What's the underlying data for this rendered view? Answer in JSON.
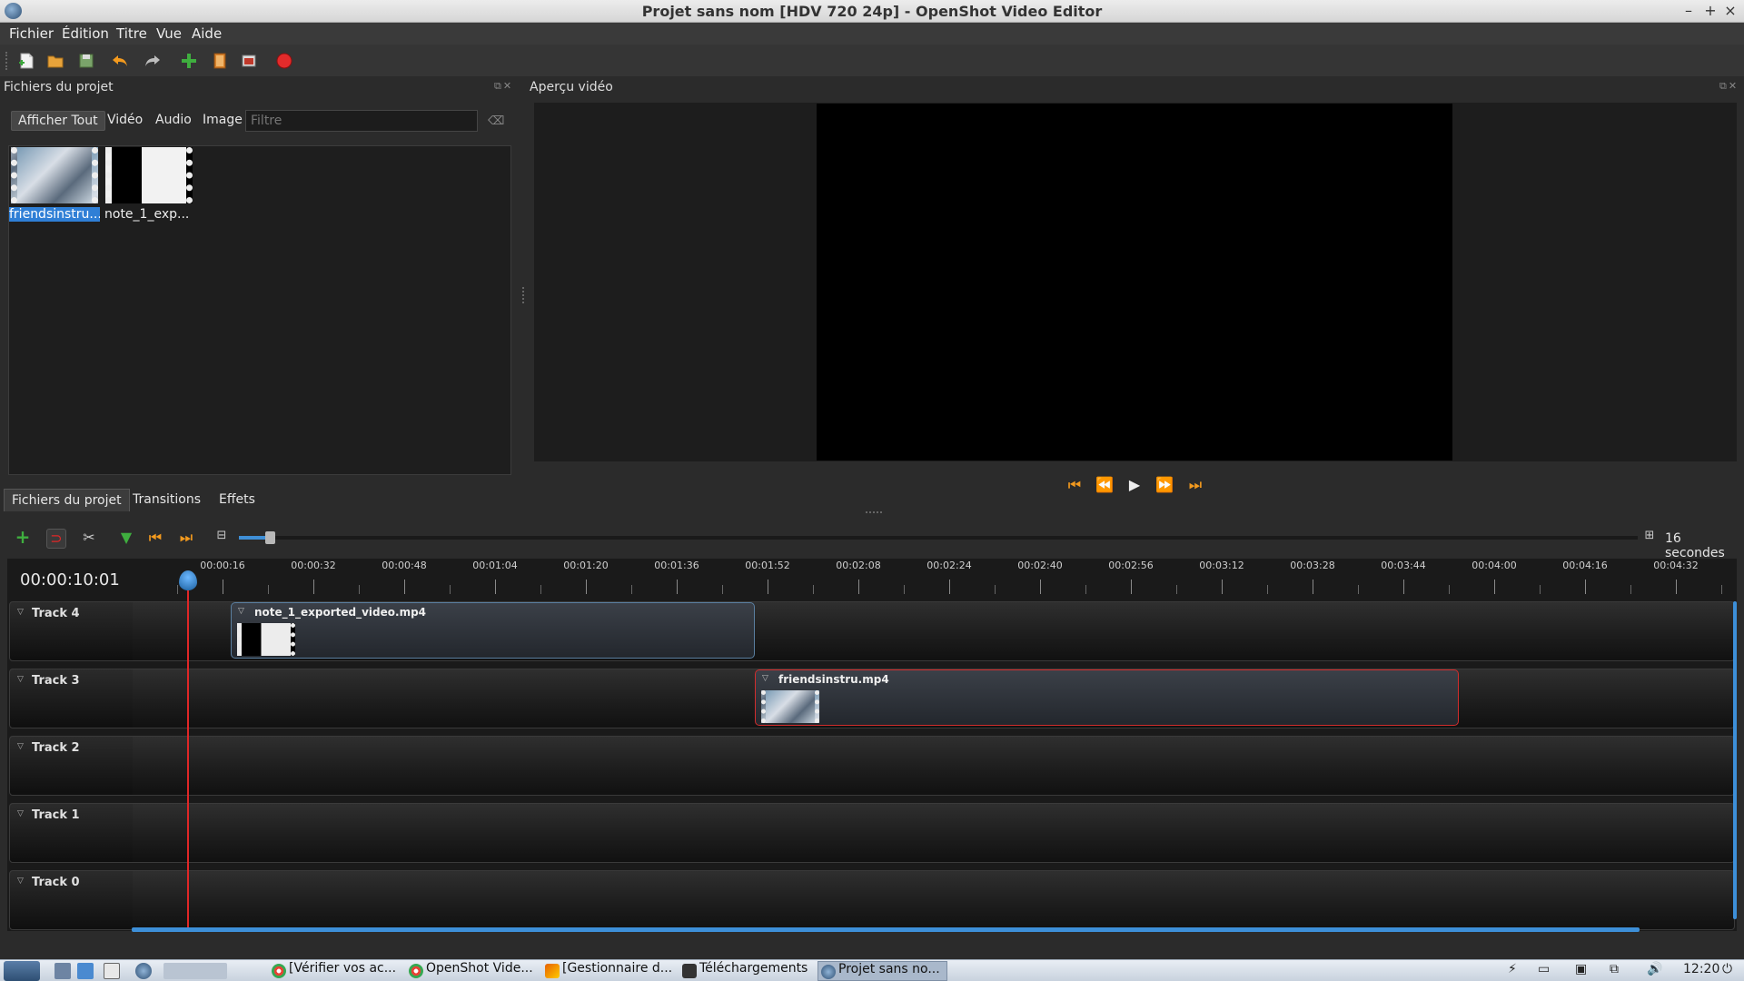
{
  "window": {
    "title": "Projet sans nom [HDV 720 24p] - OpenShot Video Editor",
    "minimize": "–",
    "maximize": "+",
    "close": "×"
  },
  "menu": [
    "Fichier",
    "Édition",
    "Titre",
    "Vue",
    "Aide"
  ],
  "toolbar_icons": [
    "new-project-icon",
    "open-project-icon",
    "save-project-icon",
    "undo-icon",
    "redo-icon",
    "import-files-icon",
    "choose-profile-icon",
    "fullscreen-icon",
    "export-video-icon"
  ],
  "project_files": {
    "title": "Fichiers du projet",
    "filters": [
      "Afficher Tout",
      "Vidéo",
      "Audio",
      "Image"
    ],
    "filter_placeholder": "Filtre",
    "files": [
      {
        "label": "friendsinstru..."
      },
      {
        "label": "note_1_exp..."
      }
    ]
  },
  "preview": {
    "title": "Aperçu vidéo"
  },
  "bottom_tabs": [
    "Fichiers du projet",
    "Transitions",
    "Effets"
  ],
  "timeline": {
    "zoom_label": "16 secondes",
    "timecode": "00:00:10:01",
    "ruler_labels": [
      "00:00:16",
      "00:00:32",
      "00:00:48",
      "00:01:04",
      "00:01:20",
      "00:01:36",
      "00:01:52",
      "00:02:08",
      "00:02:24",
      "00:02:40",
      "00:02:56",
      "00:03:12",
      "00:03:28",
      "00:03:44",
      "00:04:00",
      "00:04:16",
      "00:04:32"
    ],
    "tracks": [
      {
        "name": "Track 4",
        "clip": {
          "name": "note_1_exported_video.mp4"
        }
      },
      {
        "name": "Track 3",
        "clip": {
          "name": "friendsinstru.mp4"
        }
      },
      {
        "name": "Track 2"
      },
      {
        "name": "Track 1"
      },
      {
        "name": "Track 0"
      }
    ]
  },
  "taskbar": {
    "tasks": [
      {
        "label": "[Vérifier vos ac...",
        "icon": "chrome-icon"
      },
      {
        "label": "OpenShot Vide...",
        "icon": "chrome-icon"
      },
      {
        "label": "[Gestionnaire d...",
        "icon": "firefox-icon"
      },
      {
        "label": "Téléchargements",
        "icon": "folder-icon"
      },
      {
        "label": "Projet sans no...",
        "icon": "openshot-icon"
      }
    ],
    "clock": "12:20"
  },
  "colors": {
    "accent": "#f39a1e",
    "selection": "#3d8fd8",
    "playhead": "#e02727"
  }
}
